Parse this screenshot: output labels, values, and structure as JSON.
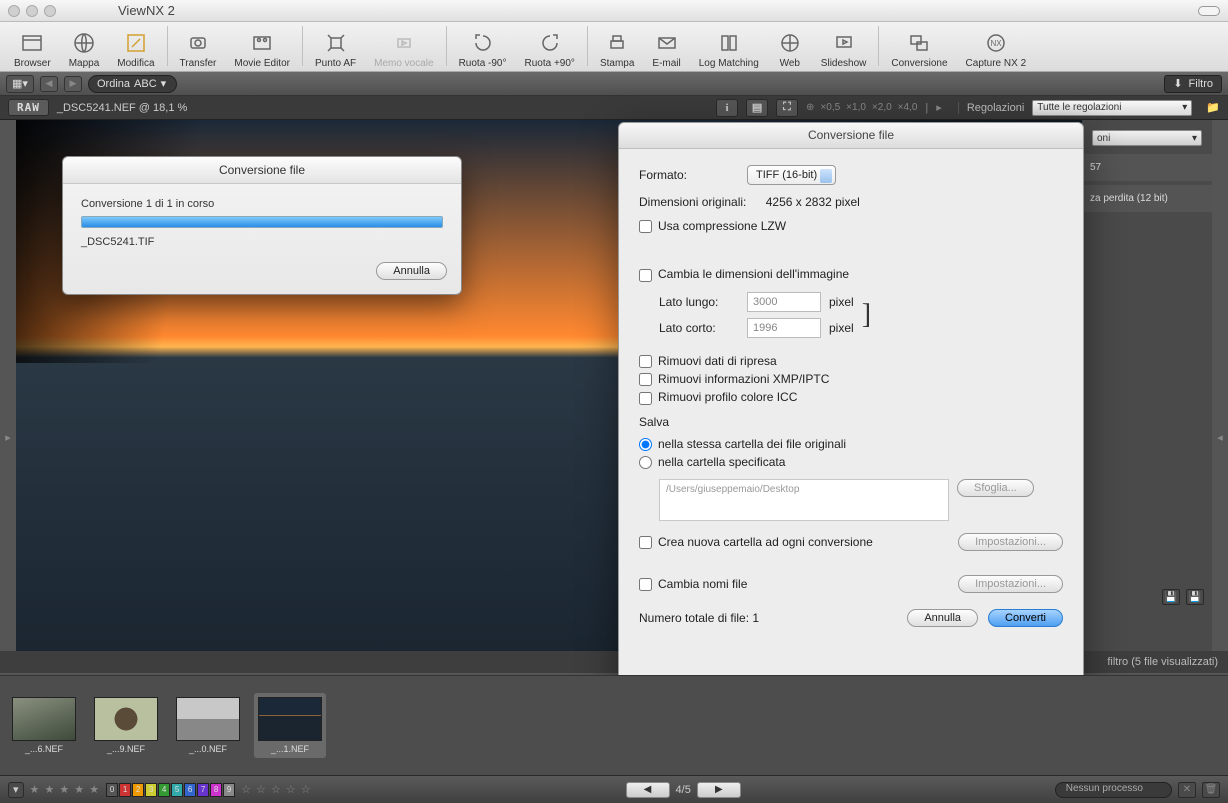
{
  "app": {
    "title": "ViewNX 2"
  },
  "toolbar": {
    "items": [
      {
        "label": "Browser"
      },
      {
        "label": "Mappa"
      },
      {
        "label": "Modifica"
      },
      {
        "label": "Transfer"
      },
      {
        "label": "Movie Editor"
      },
      {
        "label": "Punto AF"
      },
      {
        "label": "Memo vocale",
        "disabled": true
      },
      {
        "label": "Ruota -90°"
      },
      {
        "label": "Ruota +90°"
      },
      {
        "label": "Stampa"
      },
      {
        "label": "E-mail"
      },
      {
        "label": "Log Matching"
      },
      {
        "label": "Web"
      },
      {
        "label": "Slideshow"
      },
      {
        "label": "Conversione"
      },
      {
        "label": "Capture NX 2"
      }
    ]
  },
  "subbar": {
    "sort_label": "Ordina",
    "sort_mode": "ABC",
    "filter_label": "Filtro"
  },
  "infobar": {
    "raw_badge": "RAW",
    "filename_zoom": "_DSC5241.NEF @ 18,1 %",
    "zoom_levels": [
      "×0,5",
      "×1,0",
      "×2,0",
      "×4,0"
    ],
    "regolazioni_label": "Regolazioni",
    "regolazioni_select": "Tutte le regolazioni"
  },
  "right_sidebar": {
    "dropdown_fragment": "oni",
    "value_fragment": "57",
    "line_fragment": "za perdita (12 bit)"
  },
  "progress_dialog": {
    "title": "Conversione file",
    "status": "Conversione 1 di 1 in corso",
    "filename": "_DSC5241.TIF",
    "cancel": "Annulla"
  },
  "conv_dialog": {
    "title": "Conversione file",
    "format_label": "Formato:",
    "format_value": "TIFF (16-bit)",
    "orig_dims_label": "Dimensioni originali:",
    "orig_dims_value": "4256 x 2832 pixel",
    "lzw": "Usa compressione LZW",
    "resize": "Cambia le dimensioni dell'immagine",
    "long_side_label": "Lato lungo:",
    "long_side_value": "3000",
    "short_side_label": "Lato corto:",
    "short_side_value": "1996",
    "unit": "pixel",
    "rm_shoot": "Rimuovi dati di ripresa",
    "rm_xmp": "Rimuovi informazioni XMP/IPTC",
    "rm_icc": "Rimuovi profilo colore ICC",
    "save_head": "Salva",
    "save_same": "nella stessa cartella dei file originali",
    "save_spec": "nella cartella specificata",
    "path": "/Users/giuseppemaio/Desktop",
    "browse": "Sfoglia...",
    "new_folder": "Crea nuova cartella ad ogni conversione",
    "settings": "Impostazioni...",
    "rename": "Cambia nomi file",
    "total_label": "Numero totale di file:",
    "total_value": "1",
    "cancel": "Annulla",
    "convert": "Converti"
  },
  "midstrip": {
    "filter_text": "filtro (5 file visualizzati)"
  },
  "thumbs": [
    {
      "cap": "_...6.NEF"
    },
    {
      "cap": "_...9.NEF"
    },
    {
      "cap": "_...0.NEF"
    },
    {
      "cap": "_...1.NEF"
    }
  ],
  "statusbar": {
    "stars": "★ ★ ★ ★ ★",
    "labels": [
      "0",
      "1",
      "2",
      "3",
      "4",
      "5",
      "6",
      "7",
      "8",
      "9"
    ],
    "label_colors": [
      "#555",
      "#c33",
      "#e90",
      "#cc3",
      "#393",
      "#3aa",
      "#36c",
      "#63c",
      "#c3c",
      "#888"
    ],
    "page": "4/5",
    "process": "Nessun processo"
  }
}
